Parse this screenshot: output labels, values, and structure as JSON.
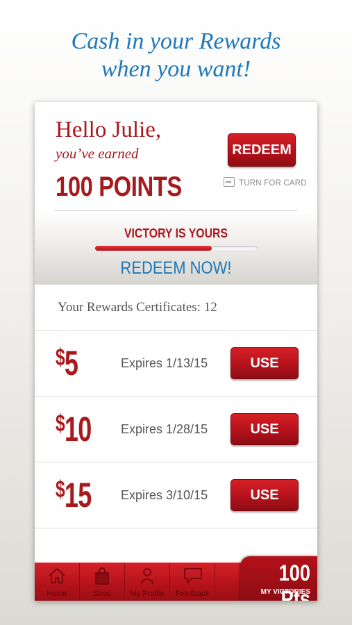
{
  "promo": {
    "line1": "Cash in your Rewards",
    "line2": "when you want!"
  },
  "header": {
    "greeting": "Hello Julie,",
    "earned": "you’ve earned",
    "points": "100 POINTS",
    "redeem_label": "REDEEM",
    "turn_for_card": "TURN FOR CARD",
    "turn_icon": "card-flip-icon"
  },
  "victory": {
    "title": "VICTORY IS YOURS",
    "progress": 0.72,
    "redeem_now": "REDEEM NOW!"
  },
  "certificates": {
    "count_label": "Your Rewards Certificates: 12",
    "items": [
      {
        "amount": "5",
        "expires": "Expires 1/13/15",
        "button": "USE"
      },
      {
        "amount": "10",
        "expires": "Expires 1/28/15",
        "button": "USE"
      },
      {
        "amount": "15",
        "expires": "Expires 3/10/15",
        "button": "USE"
      }
    ]
  },
  "tabbar": {
    "tabs": [
      {
        "label": "Home",
        "icon": "home-icon"
      },
      {
        "label": "Shop",
        "icon": "shopping-bag-icon"
      },
      {
        "label": "My Profile",
        "icon": "profile-icon"
      },
      {
        "label": "Feedback",
        "icon": "speech-bubble-icon"
      }
    ],
    "points_value": "100 Pts",
    "points_label": "MY VICTORIES"
  },
  "colors": {
    "brand_red": "#a8191e",
    "accent_blue": "#1f78b8"
  }
}
